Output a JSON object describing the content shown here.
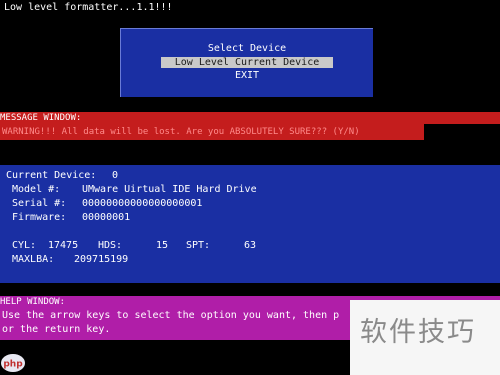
{
  "app": {
    "title": "Low level formatter...1.1!!!"
  },
  "menu": {
    "title": "Select Device",
    "items": [
      "Low Level Current Device",
      "EXIT"
    ],
    "selected_index": 0
  },
  "message_window": {
    "title": "MESSAGE WINDOW:",
    "text": "WARNING!!!  All data will be lost.  Are you ABSOLUTELY SURE??? (Y/N)"
  },
  "device": {
    "current_label": "Current Device:",
    "current_value": "0",
    "model_label": "Model  #:",
    "model_value": "UMware Uirtual IDE Hard Drive",
    "serial_label": "Serial #:",
    "serial_value": "00000000000000000001",
    "firmware_label": "Firmware:",
    "firmware_value": "00000001",
    "cyl_label": "CYL:",
    "cyl_value": "17475",
    "hds_label": "HDS:",
    "hds_value": "15",
    "spt_label": "SPT:",
    "spt_value": "63",
    "maxlba_label": "MAXLBA:",
    "maxlba_value": "209715199"
  },
  "help_window": {
    "title": "HELP WINDOW:",
    "line1": "Use the arrow keys to select the option you want, then p",
    "line2": "or the return key."
  },
  "watermark": {
    "text": "软件技巧",
    "logo_text": "php"
  },
  "colors": {
    "background": "#000000",
    "menu_blue": "#1a2fa3",
    "message_red": "#c41d1d",
    "help_magenta": "#b01ea8",
    "selected_gray": "#c9c9c9"
  }
}
